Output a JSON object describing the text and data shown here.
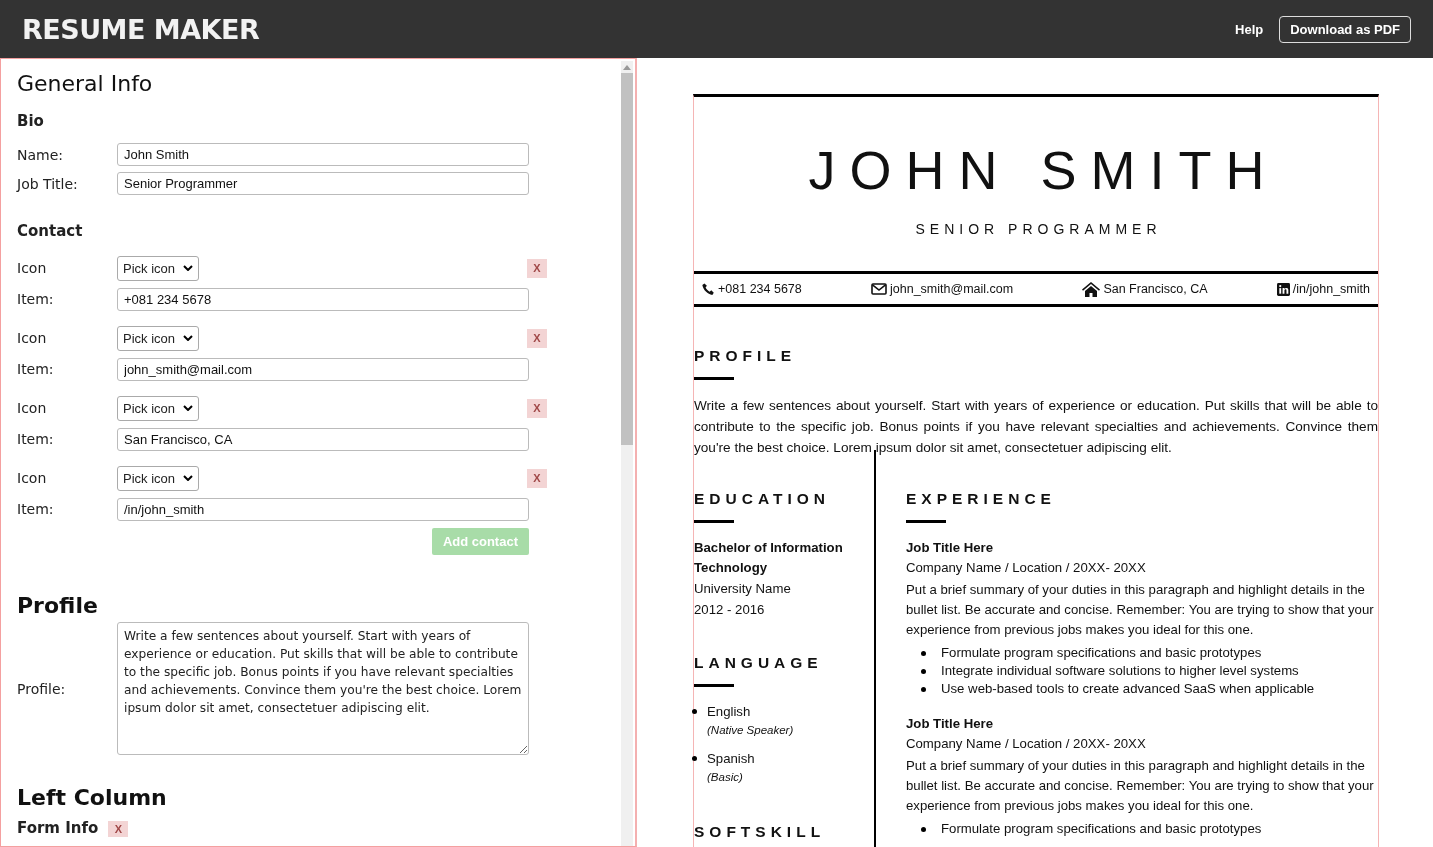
{
  "header": {
    "title": "RESUME MAKER",
    "help": "Help",
    "download": "Download as PDF"
  },
  "form": {
    "heading": "General Info",
    "bio": {
      "heading": "Bio",
      "fields": [
        {
          "label": "Name:",
          "value": "John Smith"
        },
        {
          "label": "Job Title:",
          "value": "Senior Programmer"
        }
      ]
    },
    "contact": {
      "heading": "Contact",
      "entries": [
        {
          "icon_label": "Icon",
          "select": "Pick icon",
          "remove": "X",
          "item_label": "Item:",
          "value": "+081 234 5678"
        },
        {
          "icon_label": "Icon",
          "select": "Pick icon",
          "remove": "X",
          "item_label": "Item:",
          "value": "john_smith@mail.com"
        },
        {
          "icon_label": "Icon",
          "select": "Pick icon",
          "remove": "X",
          "item_label": "Item:",
          "value": "San Francisco, CA"
        },
        {
          "icon_label": "Icon",
          "select": "Pick icon",
          "remove": "X",
          "item_label": "Item:",
          "value": "/in/john_smith"
        }
      ],
      "add_button": "Add contact"
    },
    "profile": {
      "heading": "Profile",
      "label": "Profile:",
      "value": "Write a few sentences about yourself. Start with years of experience or education. Put skills that will be able to contribute to the specific job. Bonus points if you have relevant specialties and achievements. Convince them you're the best choice. Lorem ipsum dolor sit amet, consectetuer adipiscing elit."
    },
    "left_column": {
      "heading": "Left Column",
      "subheading": "Form Info",
      "remove": "X"
    }
  },
  "resume": {
    "name": "JOHN SMITH",
    "title": "SENIOR PROGRAMMER",
    "contacts": [
      {
        "kind": "phone",
        "text": "+081 234 5678"
      },
      {
        "kind": "email",
        "text": "john_smith@mail.com"
      },
      {
        "kind": "home",
        "text": "San Francisco, CA"
      },
      {
        "kind": "linkedin",
        "text": "/in/john_smith"
      }
    ],
    "profile": {
      "heading": "PROFILE",
      "text": "Write a few sentences about yourself. Start with years of experience or education. Put skills that will be able to contribute to the specific job. Bonus points if you have relevant specialties and achievements. Convince them you're the best choice. Lorem ipsum dolor sit amet, consectetuer adipiscing elit."
    },
    "education": {
      "heading": "EDUCATION",
      "degree": "Bachelor of Information Technology",
      "school": "University Name",
      "years": "2012 - 2016"
    },
    "language": {
      "heading": "LANGUAGE",
      "items": [
        {
          "name": "English",
          "level": "(Native Speaker)"
        },
        {
          "name": "Spanish",
          "level": "(Basic)"
        }
      ]
    },
    "softskill": {
      "heading": "SOFTSKILL"
    },
    "experience": {
      "heading": "EXPERIENCE",
      "jobs": [
        {
          "title": "Job Title Here",
          "company": "Company Name / Location / 20XX- 20XX",
          "summary": "Put a brief summary of your duties in this paragraph and highlight details in the bullet list. Be accurate and concise. Remember: You are trying to show that your experience from previous jobs makes you ideal for this one.",
          "bullets": [
            "Formulate program specifications and basic prototypes",
            "Integrate individual software solutions to higher level systems",
            "Use web-based tools to create advanced SaaS when applicable"
          ]
        },
        {
          "title": "Job Title Here",
          "company": "Company Name / Location / 20XX- 20XX",
          "summary": "Put a brief summary of your duties in this paragraph and highlight details in the bullet list. Be accurate and concise. Remember: You are trying to show that your experience from previous jobs makes you ideal for this one.",
          "bullets": [
            "Formulate program specifications and basic prototypes"
          ]
        }
      ]
    }
  }
}
